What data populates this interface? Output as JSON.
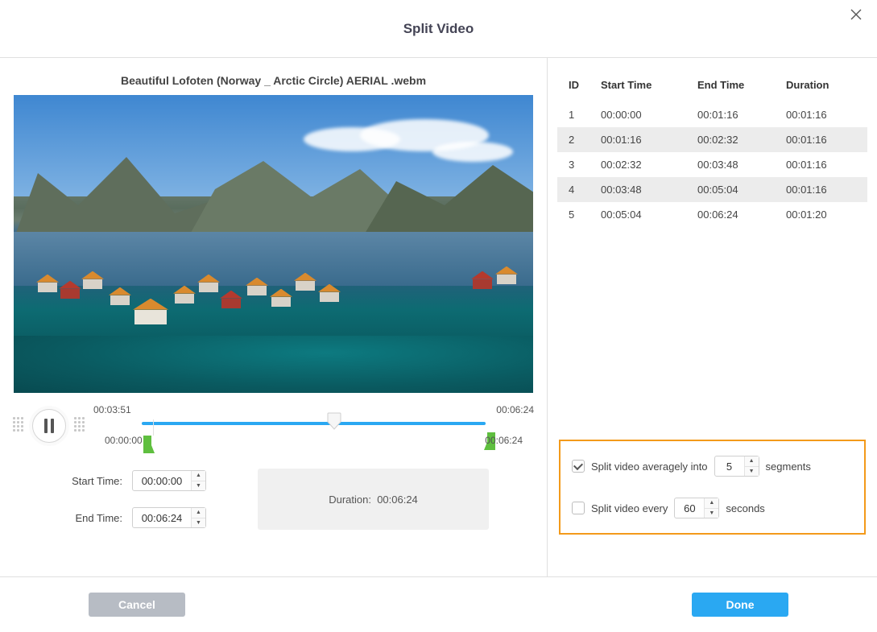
{
  "title": "Split Video",
  "filename": "Beautiful Lofoten (Norway _ Arctic Circle) AERIAL .webm",
  "playback": {
    "current": "00:03:51",
    "total": "00:06:24",
    "range_start": "00:00:00",
    "range_end": "00:06:24"
  },
  "fields": {
    "start_label": "Start Time:",
    "end_label": "End Time:",
    "start_value": "00:00:00",
    "end_value": "00:06:24"
  },
  "duration": {
    "label": "Duration:",
    "value": "00:06:24"
  },
  "table": {
    "headers": {
      "id": "ID",
      "start": "Start Time",
      "end": "End Time",
      "dur": "Duration"
    },
    "rows": [
      {
        "id": "1",
        "start": "00:00:00",
        "end": "00:01:16",
        "dur": "00:01:16"
      },
      {
        "id": "2",
        "start": "00:01:16",
        "end": "00:02:32",
        "dur": "00:01:16"
      },
      {
        "id": "3",
        "start": "00:02:32",
        "end": "00:03:48",
        "dur": "00:01:16"
      },
      {
        "id": "4",
        "start": "00:03:48",
        "end": "00:05:04",
        "dur": "00:01:16"
      },
      {
        "id": "5",
        "start": "00:05:04",
        "end": "00:06:24",
        "dur": "00:01:20"
      }
    ]
  },
  "options": {
    "avg_label_pre": "Split video averagely into",
    "avg_value": "5",
    "avg_label_post": "segments",
    "avg_checked": true,
    "every_label_pre": "Split video every",
    "every_value": "60",
    "every_label_post": "seconds",
    "every_checked": false
  },
  "buttons": {
    "cancel": "Cancel",
    "done": "Done"
  }
}
